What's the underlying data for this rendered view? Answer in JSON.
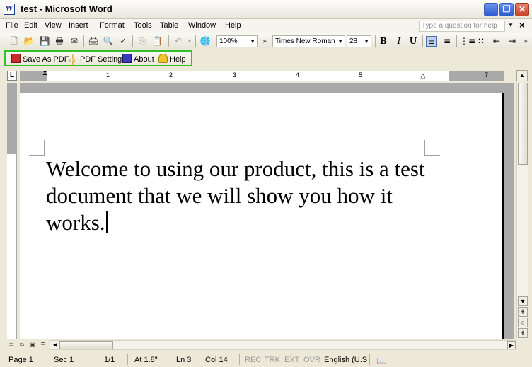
{
  "window": {
    "title": "test - Microsoft Word",
    "app_icon_letter": "W"
  },
  "menu": {
    "items": [
      {
        "label": "File",
        "access": "F"
      },
      {
        "label": "Edit",
        "access": "E"
      },
      {
        "label": "View",
        "access": "V"
      },
      {
        "label": "Insert",
        "access": "I"
      },
      {
        "label": "Format",
        "access": "o"
      },
      {
        "label": "Tools",
        "access": "T"
      },
      {
        "label": "Table",
        "access": "a"
      },
      {
        "label": "Window",
        "access": "W"
      },
      {
        "label": "Help",
        "access": "H"
      }
    ],
    "help_placeholder": "Type a question for help"
  },
  "formatting": {
    "zoom": "100%",
    "font": "Times New Roman",
    "size": "28",
    "bold": "B",
    "italic": "I",
    "underline": "U"
  },
  "pdf_toolbar": {
    "save_as_pdf": "Save As PDF",
    "pdf_setting": "PDF Setting",
    "about": "About",
    "help": "Help",
    "border_color": "#34c02a"
  },
  "ruler": {
    "numbers": [
      "1",
      "2",
      "3",
      "4",
      "5",
      "7"
    ]
  },
  "document": {
    "text": "Welcome to using our product, this is a test document that we will show you how it works."
  },
  "status": {
    "page": "Page 1",
    "section": "Sec 1",
    "pages": "1/1",
    "at": "At 1.8\"",
    "line": "Ln 3",
    "col": "Col 14",
    "rec": "REC",
    "trk": "TRK",
    "ext": "EXT",
    "ovr": "OVR",
    "language": "English (U.S"
  }
}
